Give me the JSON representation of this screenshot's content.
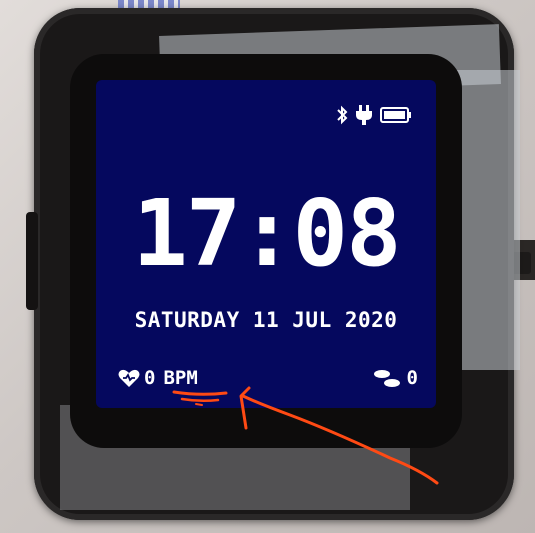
{
  "watch_face": {
    "time": "17:08",
    "date": "SATURDAY 11 JUL 2020",
    "heart_rate": {
      "value": "0",
      "unit": "BPM",
      "icon": "heart-icon"
    },
    "steps": {
      "value": "0",
      "icon": "footsteps-icon"
    },
    "status_icons": [
      "bluetooth-icon",
      "charging-plug-icon",
      "battery-icon"
    ],
    "battery_level": 1.0
  },
  "colors": {
    "screen_bg": "#05085e",
    "text": "#ffffff",
    "annotation": "#ff4a14"
  }
}
